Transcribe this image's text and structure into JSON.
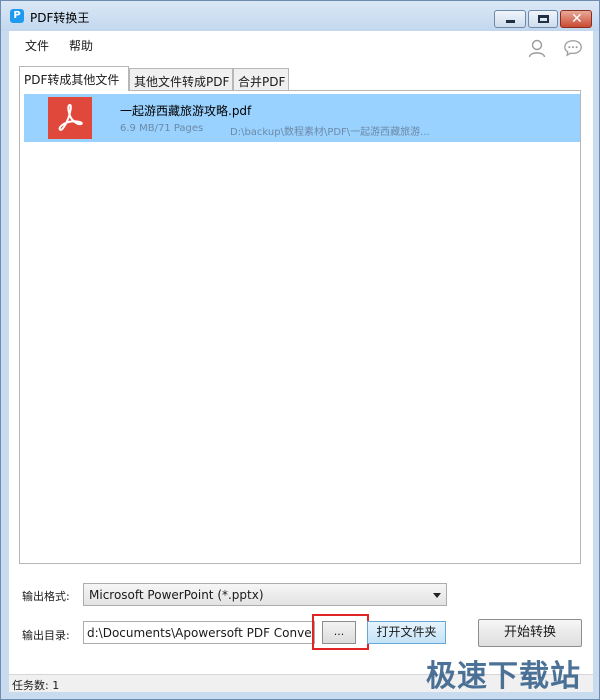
{
  "window": {
    "title": "PDF转换王",
    "app_icon_glyph": "P"
  },
  "menu": {
    "file": "文件",
    "help": "帮助"
  },
  "icons": {
    "user": "user-icon",
    "chat": "chat-icon",
    "pdf": "pdf-file-icon"
  },
  "tabs": [
    {
      "label": "PDF转成其他文件",
      "active": true
    },
    {
      "label": "其他文件转成PDF",
      "active": false
    },
    {
      "label": "合并PDF",
      "active": false
    }
  ],
  "files": [
    {
      "name": "一起游西藏旅游攻略.pdf",
      "meta": "6.9 MB/71 Pages",
      "path": "D:\\backup\\数程素材\\PDF\\一起游西藏旅游..."
    }
  ],
  "output": {
    "format_label": "输出格式:",
    "format_value": "Microsoft PowerPoint (*.pptx)",
    "dir_label": "输出目录:",
    "dir_value": "d:\\Documents\\Apowersoft PDF Conver",
    "browse_label": "...",
    "open_folder_label": "打开文件夹",
    "start_label": "开始转换"
  },
  "status": {
    "task_count": "任务数: 1"
  },
  "watermark": "极速下载站",
  "colors": {
    "selection": "#99d1ff",
    "pdf_red": "#e0483b",
    "highlight_red": "#e02424"
  }
}
